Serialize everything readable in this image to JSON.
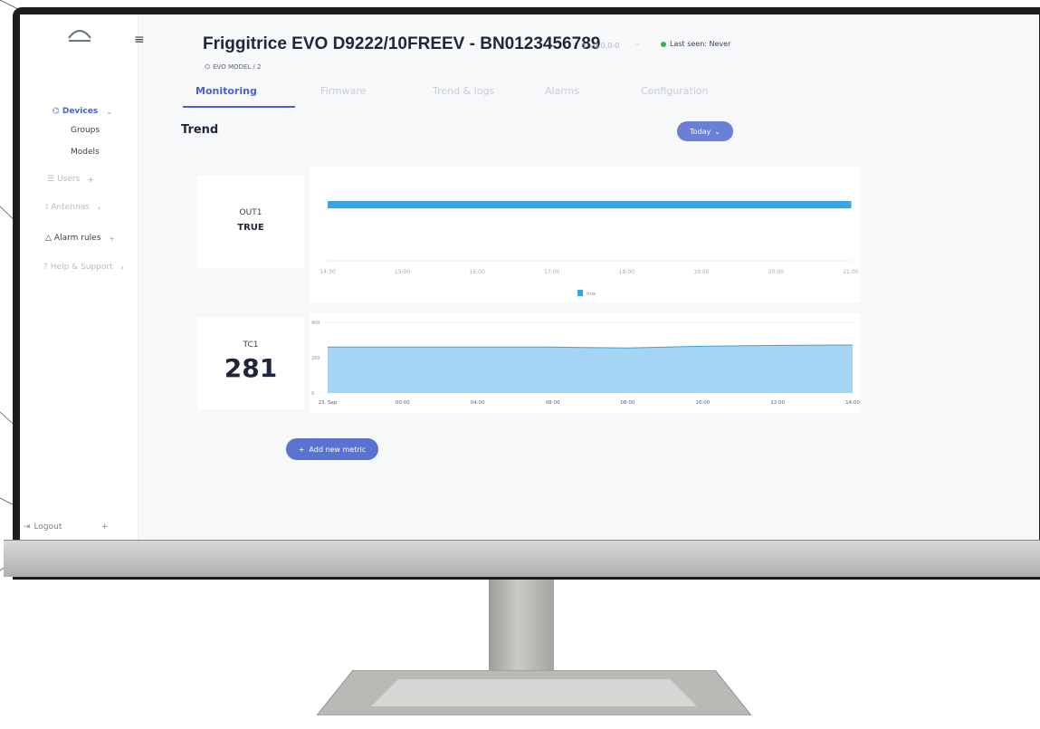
{
  "sidebar": {
    "items": [
      {
        "label": "Devices",
        "icon": "devices-icon",
        "chevron": "⌄"
      },
      {
        "label": "Groups"
      },
      {
        "label": "Models"
      },
      {
        "label": "Users",
        "icon": "users-icon",
        "chevron": "+"
      },
      {
        "label": "Antennas",
        "icon": "antenna-icon",
        "chevron": "›"
      },
      {
        "label": "Alarm rules",
        "icon": "bell-icon",
        "chevron": "+"
      },
      {
        "label": "Help & Support",
        "icon": "help-icon",
        "chevron": "›"
      }
    ],
    "logout_label": "Logout",
    "logout_extra": "+"
  },
  "device": {
    "title": "Friggitrice EVO D9222/10FREEV - BN0123456789",
    "version": "v0.0.0-0",
    "last_seen": "Last seen: Never",
    "model": "EVO MODEL / 2"
  },
  "tabs": [
    {
      "label": "Monitoring"
    },
    {
      "label": "Firmware"
    },
    {
      "label": "Trend & logs"
    },
    {
      "label": "Alarms"
    },
    {
      "label": "Configuration"
    }
  ],
  "trend": {
    "title": "Trend",
    "range_button": "Today"
  },
  "metrics": [
    {
      "name": "OUT1",
      "value": "TRUE"
    },
    {
      "name": "TC1",
      "value": "281"
    }
  ],
  "chart_data": [
    {
      "type": "bar",
      "series": [
        {
          "name": "true",
          "color": "#35a7e4",
          "values": [
            1,
            1,
            1,
            1,
            1,
            1,
            1,
            1
          ]
        }
      ],
      "x": [
        "14:30",
        "15:00",
        "16:00",
        "17:00",
        "18:00",
        "19:00",
        "20:00",
        "21:00"
      ],
      "legend": "bottom-center"
    },
    {
      "type": "area",
      "x": [
        "23. Sep",
        "00:00",
        "04:00",
        "08:00",
        "08:00",
        "16:00",
        "12:00",
        "14:00"
      ],
      "y": [
        260,
        260,
        260,
        260,
        255,
        265,
        270,
        272
      ],
      "yticks": [
        "400",
        "200",
        "0"
      ],
      "ylim": [
        0,
        400
      ],
      "color": "#9fd3f3",
      "line_color": "#3aa3de"
    }
  ],
  "add_metric_label": "Add new metric",
  "colors": {
    "accent": "#4a63c8",
    "button": "#6a7fd6",
    "status_green": "#35b44f"
  }
}
